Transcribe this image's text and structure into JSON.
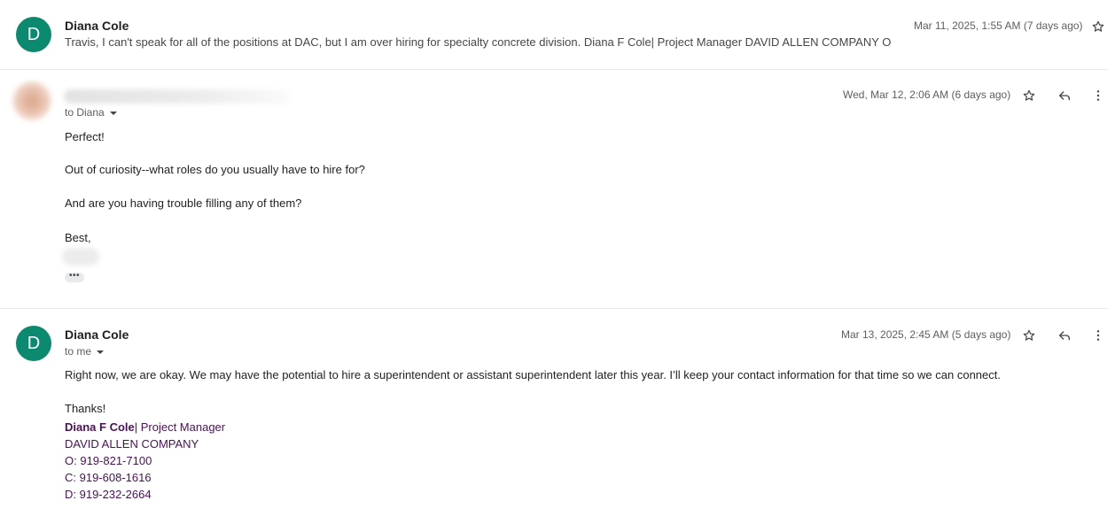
{
  "messages": [
    {
      "sender": "Diana Cole",
      "avatar_letter": "D",
      "snippet": "Travis, I can't speak for all of the positions at DAC, but I am over hiring for specialty concrete division. Diana F Cole| Project Manager DAVID ALLEN COMPANY O",
      "date": "Mar 11, 2025, 1:55 AM (7 days ago)"
    },
    {
      "to": "to Diana",
      "date": "Wed, Mar 12, 2:06 AM (6 days ago)",
      "body": [
        "Perfect!",
        "Out of curiosity--what roles do you usually have to hire for?",
        "And are you having trouble filling any of them?",
        "Best,"
      ],
      "ellipsis": "•••"
    },
    {
      "sender": "Diana Cole",
      "avatar_letter": "D",
      "to": "to me",
      "date": "Mar 13, 2025, 2:45 AM (5 days ago)",
      "body": [
        "Right now, we are okay. We may have the potential to hire a superintendent or assistant superintendent later this year. I’ll keep your contact information for that time so we can connect.",
        "Thanks!"
      ],
      "signature": {
        "name": "Diana F Cole",
        "title": "| Project Manager",
        "company": "DAVID ALLEN COMPANY",
        "office": "O: 919-821-7100",
        "cell": "C: 919-608-1616",
        "direct": "D: 919-232-2664"
      }
    }
  ],
  "icons": {
    "star": "star-icon",
    "reply": "reply-icon",
    "more": "more-vert-icon"
  },
  "colors": {
    "avatar": "#0b8a6f",
    "signature": "#4a1259"
  }
}
